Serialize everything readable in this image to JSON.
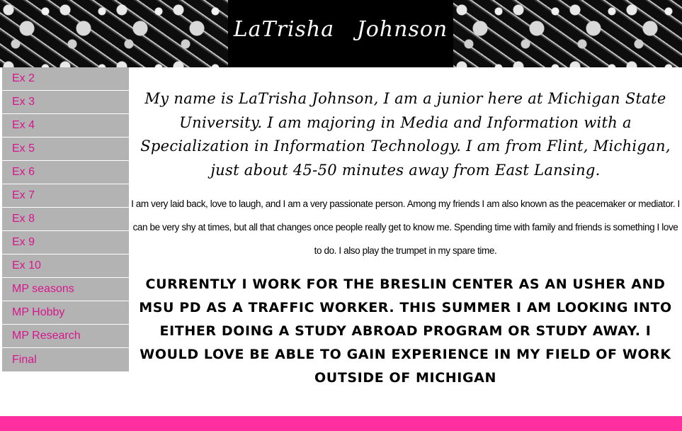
{
  "header": {
    "title": "LaTrisha   Johnson"
  },
  "sidebar": {
    "items": [
      {
        "label": "Ex 2"
      },
      {
        "label": "Ex 3"
      },
      {
        "label": "Ex 4"
      },
      {
        "label": "Ex 5"
      },
      {
        "label": "Ex 6"
      },
      {
        "label": "Ex 7"
      },
      {
        "label": "Ex 8"
      },
      {
        "label": "Ex 9"
      },
      {
        "label": "Ex 10"
      },
      {
        "label": "MP seasons"
      },
      {
        "label": "MP Hobby"
      },
      {
        "label": "MP Research"
      },
      {
        "label": "Final"
      }
    ]
  },
  "main": {
    "intro": "My name is LaTrisha Johnson, I am a junior here at Michigan State University. I am majoring in Media and Information with a Specialization in Information Technology. I am from Flint, Michigan, just about 45-50 minutes away from East Lansing.",
    "about": "I am very laid back, love to laugh, and I am a very passionate person. Among my friends I am also known as the peacemaker or mediator. I can be very shy at times, but all that changes once people really get to know me. Spending time with family and friends is something I love to do. I also play the trumpet in my spare time.",
    "current": "Currently I work for the Breslin Center as an Usher and MSU PD as a traffic worker. This summer I am looking into either doing a study abroad program or study away. I would love be able to gain experience in my field of work outside of Michigan"
  },
  "colors": {
    "nav_background": "#b3b3b3",
    "nav_text": "#d6168c",
    "footer_bar": "#ff2fa0",
    "title_box": "#000000"
  }
}
